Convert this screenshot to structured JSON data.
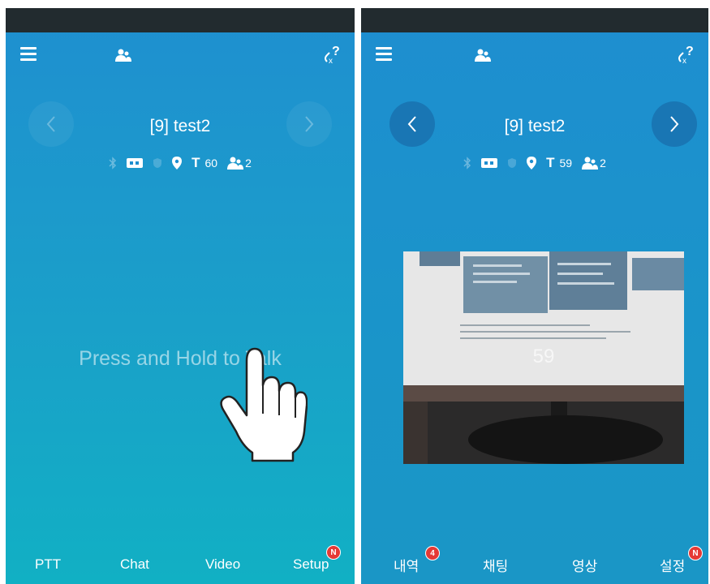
{
  "left_screen": {
    "contact_title": "[9] test2",
    "timer": "60",
    "member_count": "2",
    "press_hint": "Press and Hold to Talk",
    "tabs": [
      {
        "label": "PTT"
      },
      {
        "label": "Chat"
      },
      {
        "label": "Video"
      },
      {
        "label": "Setup",
        "badge": "N"
      }
    ]
  },
  "right_screen": {
    "contact_title": "[9] test2",
    "timer": "59",
    "member_count": "2",
    "video_countdown": "59",
    "tabs": [
      {
        "label": "내역",
        "badge": "4"
      },
      {
        "label": "채팅"
      },
      {
        "label": "영상"
      },
      {
        "label": "설정",
        "badge": "N"
      }
    ]
  },
  "colors": {
    "accent": "#1f8fd0",
    "badge": "#e53935",
    "statusbar": "#222b2f"
  },
  "icons": [
    "menu-icon",
    "users-icon",
    "link-question-icon",
    "chevron-left-icon",
    "chevron-right-icon",
    "bluetooth-icon",
    "card-icon",
    "shield-icon",
    "location-icon",
    "timer-icon",
    "members-icon",
    "hand-icon"
  ]
}
